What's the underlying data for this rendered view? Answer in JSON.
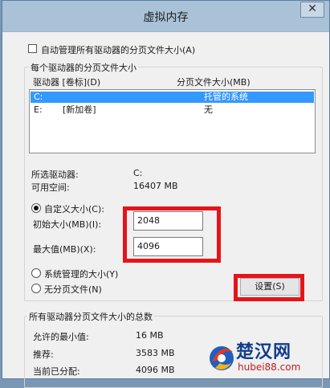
{
  "window": {
    "title": "虚拟内存",
    "close_label": "✕"
  },
  "auto_manage": {
    "label": "自动管理所有驱动器的分页文件大小(A)",
    "checked": false
  },
  "per_drive_group": {
    "legend": "每个驱动器的分页文件大小",
    "columns": {
      "drive": "驱动器 [卷标](D)",
      "paging_size": "分页文件大小(MB)"
    },
    "drives": [
      {
        "drive": "C:",
        "label": "",
        "paging": "托管的系统",
        "selected": true
      },
      {
        "drive": "E:",
        "label": "[新加卷]",
        "paging": "无",
        "selected": false
      }
    ],
    "selected_drive_label": "所选驱动器:",
    "selected_drive_value": "C:",
    "free_space_label": "可用空间:",
    "free_space_value": "16407 MB",
    "custom_size": {
      "label": "自定义大小(C):",
      "checked": true
    },
    "initial_size": {
      "label": "初始大小(MB)(I):",
      "value": "2048"
    },
    "max_size": {
      "label": "最大值(MB)(X):",
      "value": "4096"
    },
    "system_managed": {
      "label": "系统管理的大小(Y)",
      "checked": false
    },
    "no_paging": {
      "label": "无分页文件(N)",
      "checked": false
    },
    "set_button": "设置(S)"
  },
  "totals_group": {
    "legend": "所有驱动器分页文件大小的总数",
    "min_allowed_label": "允许的最小值:",
    "min_allowed_value": "16 MB",
    "recommended_label": "推荐:",
    "recommended_value": "3583 MB",
    "current_label": "当前已分配:",
    "current_value": "4096 MB"
  },
  "watermark": {
    "title": "楚汉网",
    "url": "hubei88.com"
  },
  "colors": {
    "highlight": "#e5141b",
    "selection": "#3399ff"
  }
}
